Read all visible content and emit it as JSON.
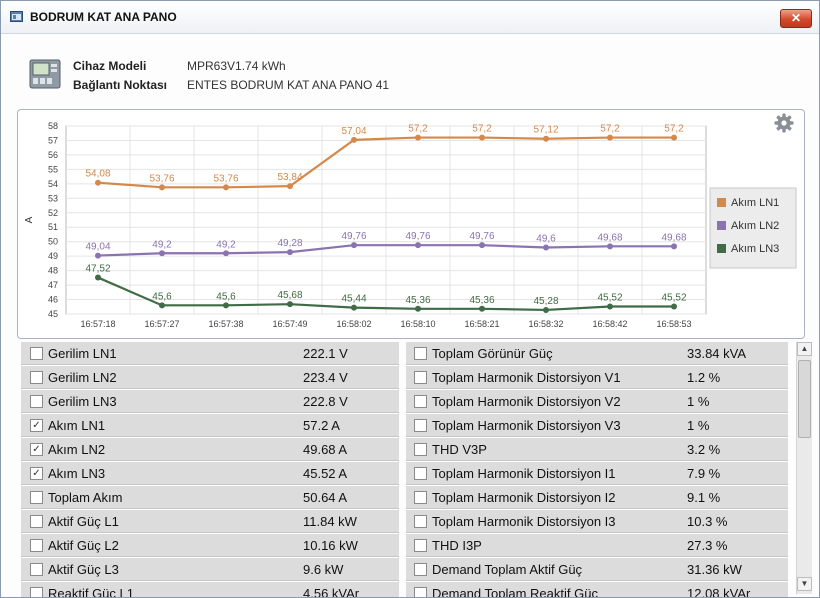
{
  "window": {
    "title": "BODRUM KAT ANA PANO",
    "close_label": "✕"
  },
  "device": {
    "model_label": "Cihaz Modeli",
    "model_value": "MPR63V1.74 kWh",
    "connection_label": "Bağlantı Noktası",
    "connection_value": "ENTES BODRUM KAT ANA PANO 41"
  },
  "colors": {
    "ln1": "#d4894a",
    "ln2": "#8a73b0",
    "ln3": "#3f6b45"
  },
  "chart_data": {
    "type": "line",
    "ylabel": "A",
    "ylim": [
      45,
      58
    ],
    "yticks": [
      45,
      46,
      47,
      48,
      49,
      50,
      51,
      52,
      53,
      54,
      55,
      56,
      57,
      58
    ],
    "categories": [
      "16:57:18",
      "16:57:27",
      "16:57:38",
      "16:57:49",
      "16:58:02",
      "16:58:10",
      "16:58:21",
      "16:58:32",
      "16:58:42",
      "16:58:53"
    ],
    "series": [
      {
        "name": "Akım LN1",
        "labels": [
          "54,08",
          "53,76",
          "53,76",
          "53,84",
          "57,04",
          "57,2",
          "57,2",
          "57,12",
          "57,2",
          "57,2"
        ],
        "values": [
          54.08,
          53.76,
          53.76,
          53.84,
          57.04,
          57.2,
          57.2,
          57.12,
          57.2,
          57.2
        ]
      },
      {
        "name": "Akım LN2",
        "labels": [
          "49,04",
          "49,2",
          "49,2",
          "49,28",
          "49,76",
          "49,76",
          "49,76",
          "49,6",
          "49,68",
          "49,68"
        ],
        "values": [
          49.04,
          49.2,
          49.2,
          49.28,
          49.76,
          49.76,
          49.76,
          49.6,
          49.68,
          49.68
        ]
      },
      {
        "name": "Akım LN3",
        "labels": [
          "47,52",
          "45,6",
          "45,6",
          "45,68",
          "45,44",
          "45,36",
          "45,36",
          "45,28",
          "45,52",
          "45,52"
        ],
        "values": [
          47.52,
          45.6,
          45.6,
          45.68,
          45.44,
          45.36,
          45.36,
          45.28,
          45.52,
          45.52
        ]
      }
    ],
    "grid": true,
    "legend": "right"
  },
  "grid": {
    "left": [
      {
        "label": "Gerilim LN1",
        "value": "222.1 V",
        "checked": false
      },
      {
        "label": "Gerilim LN2",
        "value": "223.4 V",
        "checked": false
      },
      {
        "label": "Gerilim LN3",
        "value": "222.8 V",
        "checked": false
      },
      {
        "label": "Akım LN1",
        "value": "57.2 A",
        "checked": true
      },
      {
        "label": "Akım LN2",
        "value": "49.68 A",
        "checked": true
      },
      {
        "label": "Akım LN3",
        "value": "45.52 A",
        "checked": true
      },
      {
        "label": "Toplam Akım",
        "value": "50.64 A",
        "checked": false
      },
      {
        "label": "Aktif Güç L1",
        "value": "11.84 kW",
        "checked": false
      },
      {
        "label": "Aktif Güç L2",
        "value": "10.16 kW",
        "checked": false
      },
      {
        "label": "Aktif Güç L3",
        "value": "9.6 kW",
        "checked": false
      },
      {
        "label": "Reaktif Güç L1",
        "value": "4.56 kVAr",
        "checked": false
      }
    ],
    "right": [
      {
        "label": "Toplam Görünür Güç",
        "value": "33.84 kVA",
        "checked": false
      },
      {
        "label": "Toplam Harmonik Distorsiyon V1",
        "value": "1.2 %",
        "checked": false
      },
      {
        "label": "Toplam Harmonik Distorsiyon V2",
        "value": "1 %",
        "checked": false
      },
      {
        "label": "Toplam Harmonik Distorsiyon V3",
        "value": "1 %",
        "checked": false
      },
      {
        "label": "THD V3P",
        "value": "3.2 %",
        "checked": false
      },
      {
        "label": "Toplam Harmonik Distorsiyon I1",
        "value": "7.9 %",
        "checked": false
      },
      {
        "label": "Toplam Harmonik Distorsiyon I2",
        "value": "9.1 %",
        "checked": false
      },
      {
        "label": "Toplam Harmonik Distorsiyon I3",
        "value": "10.3 %",
        "checked": false
      },
      {
        "label": "THD I3P",
        "value": "27.3 %",
        "checked": false
      },
      {
        "label": "Demand Toplam Aktif Güç",
        "value": "31.36 kW",
        "checked": false
      },
      {
        "label": "Demand Toplam Reaktif Güç",
        "value": "12.08 kVAr",
        "checked": false
      }
    ]
  },
  "scroll": {
    "up_icon": "▲",
    "down_icon": "▼"
  }
}
